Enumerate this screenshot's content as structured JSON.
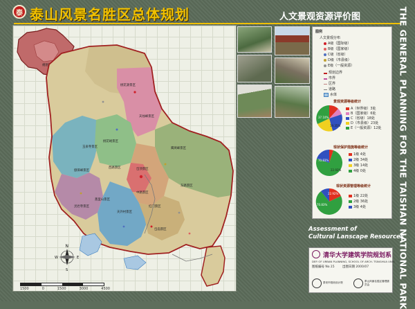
{
  "header": {
    "title": "泰山风景名胜区总体规划",
    "subtitle": "人文景观资源评价图",
    "logo_text": "泰"
  },
  "vertical_title": "THE GENERAL PLANNING FOR THE TAISHAN NATIONAL PARK",
  "inset_map": {
    "label": "规划范围"
  },
  "map": {
    "zone_labels": [
      "桃花源景区",
      "天烛峰景区",
      "玉泉寺景区",
      "岱顶景区",
      "桃花峪景区",
      "鹰窝峰景区",
      "傲徕峰景区",
      "西路景区",
      "灵岩寺景区",
      "中路景区",
      "红门景区",
      "天外村景区",
      "东路景区",
      "蒿里山景区",
      "岱庙景区"
    ],
    "scale_labels": [
      "1500",
      "0",
      "1500",
      "3000",
      "4500"
    ],
    "north_label": "N",
    "compass": {
      "w": "W",
      "e": "E",
      "s": "S"
    }
  },
  "legend": {
    "title": "图例",
    "resource_title": "人文景观分布",
    "grades": [
      {
        "label": "A级（国际级）",
        "color": "#d0202a"
      },
      {
        "label": "B级（国家级）",
        "color": "#e06060"
      },
      {
        "label": "C级（省级）",
        "color": "#5070c0"
      },
      {
        "label": "D级（市县级）",
        "color": "#c0a030"
      },
      {
        "label": "E级（一般资源）",
        "color": "#909090"
      }
    ],
    "lines": [
      {
        "label": "规划边界",
        "color": "#c02020"
      },
      {
        "label": "市界",
        "color": "#c050a0"
      },
      {
        "label": "区界",
        "color": "#c08080"
      },
      {
        "label": "道路",
        "color": "#808080"
      },
      {
        "label": "水体",
        "color": "#4080c0"
      }
    ],
    "chart1": {
      "title": "景观资源等级统计",
      "items": [
        {
          "label": "A（世界级）3处",
          "color": "#e03020"
        },
        {
          "label": "B（国家级）6处",
          "color": "#e080c0"
        },
        {
          "label": "C（省级）18处",
          "color": "#3050c0"
        },
        {
          "label": "D（市县级）23处",
          "color": "#f0d020"
        },
        {
          "label": "E（一般资源）12处",
          "color": "#30a040"
        }
      ],
      "pct": [
        "37.10%",
        "19.35%"
      ]
    },
    "chart2": {
      "title": "现状保护措施等级统计",
      "items": [
        {
          "label": "1级  4处",
          "color": "#e03020"
        },
        {
          "label": "2级  34处",
          "color": "#3050c0"
        },
        {
          "label": "3级  14处",
          "color": "#f0d020"
        },
        {
          "label": "4级  0处",
          "color": "#30a040"
        }
      ],
      "pct": [
        "70.83%",
        "22.92%"
      ]
    },
    "chart3": {
      "title": "现状资源管理等级统计",
      "items": [
        {
          "label": "1级  22处",
          "color": "#e03020"
        },
        {
          "label": "2级  36处",
          "color": "#30a040"
        },
        {
          "label": "3级  4处",
          "color": "#3050c0"
        }
      ],
      "pct": [
        "70.83%",
        "22.92%"
      ]
    }
  },
  "assessment": {
    "line1": "Assessment of",
    "line2": "Cultural Lanscape Resources"
  },
  "university": {
    "name": "清华大学建筑学院规划系",
    "english": "DEP. OF URBAN PLANNING, SCHOOL OF ARCH. TSINGHUA UNIV.",
    "number_label": "图纸编号 No.15",
    "date_label": "出图日期 2000/07",
    "orgs": [
      "泰安市规划设计院",
      "泰山风景名胜区管理委员会"
    ]
  }
}
